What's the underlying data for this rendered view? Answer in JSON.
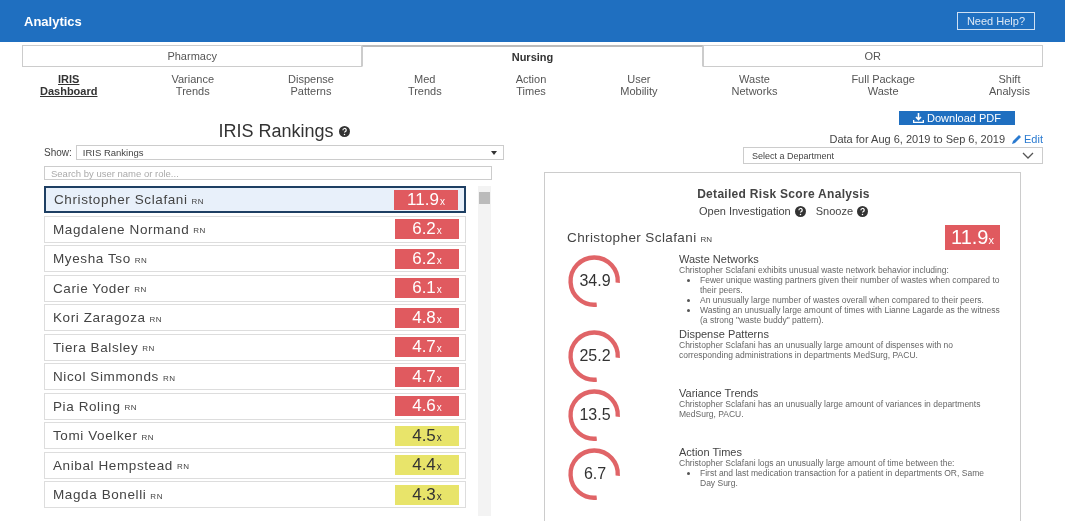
{
  "header": {
    "title": "Analytics",
    "help_button": "Need Help?"
  },
  "tabs": [
    {
      "label": "Pharmacy",
      "selected": false
    },
    {
      "label": "Nursing",
      "selected": true
    },
    {
      "label": "OR",
      "selected": false
    }
  ],
  "subnav": [
    {
      "lines": [
        "IRIS",
        "Dashboard"
      ],
      "selected": true
    },
    {
      "lines": [
        "Variance",
        "Trends"
      ],
      "selected": false
    },
    {
      "lines": [
        "Dispense",
        "Patterns"
      ],
      "selected": false
    },
    {
      "lines": [
        "Med",
        "Trends"
      ],
      "selected": false
    },
    {
      "lines": [
        "Action",
        "Times"
      ],
      "selected": false
    },
    {
      "lines": [
        "User",
        "Mobility"
      ],
      "selected": false
    },
    {
      "lines": [
        "Waste",
        "Networks"
      ],
      "selected": false
    },
    {
      "lines": [
        "Full Package",
        "Waste"
      ],
      "selected": false
    },
    {
      "lines": [
        "Shift",
        "Analysis"
      ],
      "selected": false
    }
  ],
  "rankings": {
    "title": "IRIS Rankings",
    "show_label": "Show:",
    "show_value": "IRIS Rankings",
    "search_placeholder": "Search by user name or role...",
    "rows": [
      {
        "name": "Christopher Sclafani",
        "role": "RN",
        "score": "11.9",
        "unit": "x",
        "color": "#e05a5f",
        "selected": true
      },
      {
        "name": "Magdalene Normand",
        "role": "RN",
        "score": "6.2",
        "unit": "x",
        "color": "#e05a5f",
        "selected": false
      },
      {
        "name": "Myesha Tso",
        "role": "RN",
        "score": "6.2",
        "unit": "x",
        "color": "#e05a5f",
        "selected": false
      },
      {
        "name": "Carie Yoder",
        "role": "RN",
        "score": "6.1",
        "unit": "x",
        "color": "#e05a5f",
        "selected": false
      },
      {
        "name": "Kori Zaragoza",
        "role": "RN",
        "score": "4.8",
        "unit": "x",
        "color": "#e05a5f",
        "selected": false
      },
      {
        "name": "Tiera Balsley",
        "role": "RN",
        "score": "4.7",
        "unit": "x",
        "color": "#e05a5f",
        "selected": false
      },
      {
        "name": "Nicol Simmonds",
        "role": "RN",
        "score": "4.7",
        "unit": "x",
        "color": "#e05a5f",
        "selected": false
      },
      {
        "name": "Pia Roling",
        "role": "RN",
        "score": "4.6",
        "unit": "x",
        "color": "#e05a5f",
        "selected": false
      },
      {
        "name": "Tomi Voelker",
        "role": "RN",
        "score": "4.5",
        "unit": "x",
        "color": "#e8e46a",
        "selected": false
      },
      {
        "name": "Anibal Hempstead",
        "role": "RN",
        "score": "4.4",
        "unit": "x",
        "color": "#e8e46a",
        "selected": false
      },
      {
        "name": "Magda Bonelli",
        "role": "RN",
        "score": "4.3",
        "unit": "x",
        "color": "#e8e46a",
        "selected": false
      }
    ]
  },
  "detail": {
    "download_button": "Download PDF",
    "date_range": "Data for Aug 6, 2019 to Sep 6, 2019",
    "edit_link": "Edit",
    "department_placeholder": "Select a Department",
    "title": "Detailed Risk Score Analysis",
    "actions": [
      "Open Investigation",
      "Snooze"
    ],
    "person": {
      "name": "Christopher Sclafani",
      "role": "RN",
      "score": "11.9",
      "unit": "x"
    },
    "factors": [
      {
        "score": "34.9",
        "title": "Waste Networks",
        "text": "Christopher Sclafani exhibits unusual waste network behavior including:",
        "bullets": [
          "Fewer unique wasting partners given their number of wastes when compared to their peers.",
          "An unusually large number of wastes overall when compared to their peers.",
          "Wasting an unusually large amount of times with Lianne Lagarde as the witness (a strong \"waste buddy\" pattern)."
        ]
      },
      {
        "score": "25.2",
        "title": "Dispense Patterns",
        "text": "Christopher Sclafani has an unusually large amount of dispenses with no corresponding administrations in departments MedSurg, PACU."
      },
      {
        "score": "13.5",
        "title": "Variance Trends",
        "text": "Christopher Sclafani has an unusually large amount of variances in departments MedSurg, PACU."
      },
      {
        "score": "6.7",
        "title": "Action Times",
        "text": "Christopher Sclafani logs an unusually large amount of time between the:",
        "bullets": [
          "First and last medication transaction for a patient in departments OR, Same Day Surg."
        ]
      }
    ]
  }
}
